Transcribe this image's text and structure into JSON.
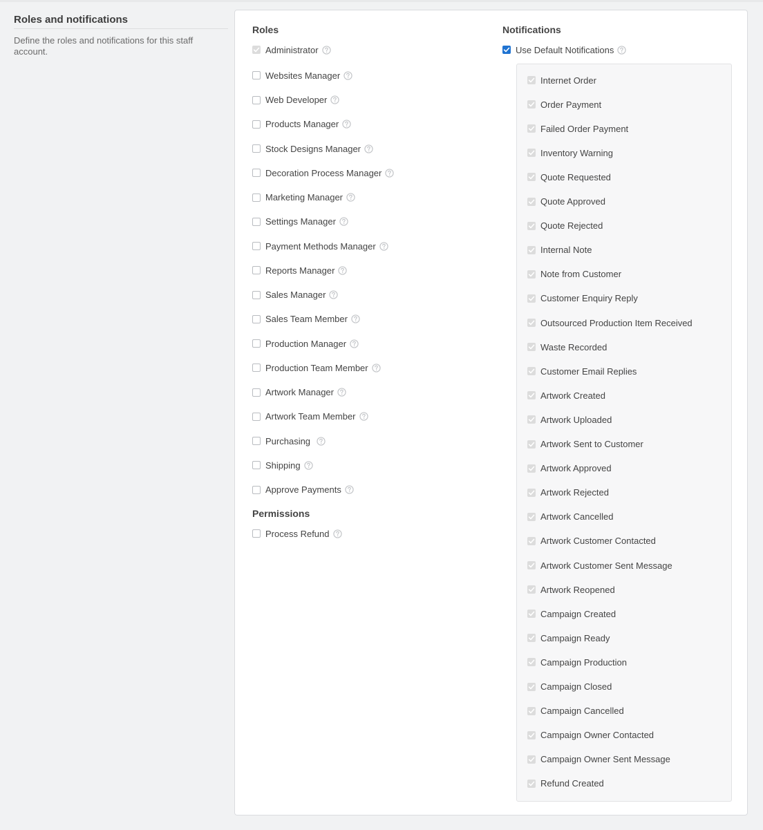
{
  "section": {
    "title": "Roles and notifications",
    "description": "Define the roles and notifications for this staff account."
  },
  "roles": {
    "heading": "Roles",
    "items": [
      {
        "label": "Administrator",
        "state": "disabled-checked"
      },
      {
        "label": "Websites Manager",
        "state": "unchecked"
      },
      {
        "label": "Web Developer",
        "state": "unchecked"
      },
      {
        "label": "Products Manager",
        "state": "unchecked"
      },
      {
        "label": "Stock Designs Manager",
        "state": "unchecked"
      },
      {
        "label": "Decoration Process Manager",
        "state": "unchecked"
      },
      {
        "label": "Marketing Manager",
        "state": "unchecked"
      },
      {
        "label": "Settings Manager",
        "state": "unchecked"
      },
      {
        "label": "Payment Methods Manager",
        "state": "unchecked"
      },
      {
        "label": "Reports Manager",
        "state": "unchecked"
      },
      {
        "label": "Sales Manager",
        "state": "unchecked"
      },
      {
        "label": "Sales Team Member",
        "state": "unchecked"
      },
      {
        "label": "Production Manager",
        "state": "unchecked"
      },
      {
        "label": "Production Team Member",
        "state": "unchecked"
      },
      {
        "label": "Artwork Manager",
        "state": "unchecked"
      },
      {
        "label": "Artwork Team Member",
        "state": "unchecked"
      },
      {
        "label": "Purchasing",
        "state": "unchecked"
      },
      {
        "label": "Shipping",
        "state": "unchecked"
      },
      {
        "label": "Approve Payments",
        "state": "unchecked"
      }
    ]
  },
  "permissions": {
    "heading": "Permissions",
    "items": [
      {
        "label": "Process Refund",
        "state": "unchecked"
      }
    ]
  },
  "notifications": {
    "heading": "Notifications",
    "use_default": {
      "label": "Use Default Notifications",
      "state": "checked"
    },
    "items": [
      {
        "label": "Internet Order",
        "state": "disabled-checked"
      },
      {
        "label": "Order Payment",
        "state": "disabled-checked"
      },
      {
        "label": "Failed Order Payment",
        "state": "disabled-checked"
      },
      {
        "label": "Inventory Warning",
        "state": "disabled-checked"
      },
      {
        "label": "Quote Requested",
        "state": "disabled-checked"
      },
      {
        "label": "Quote Approved",
        "state": "disabled-checked"
      },
      {
        "label": "Quote Rejected",
        "state": "disabled-checked"
      },
      {
        "label": "Internal Note",
        "state": "disabled-checked"
      },
      {
        "label": "Note from Customer",
        "state": "disabled-checked"
      },
      {
        "label": "Customer Enquiry Reply",
        "state": "disabled-checked"
      },
      {
        "label": "Outsourced Production Item Received",
        "state": "disabled-checked"
      },
      {
        "label": "Waste Recorded",
        "state": "disabled-checked"
      },
      {
        "label": "Customer Email Replies",
        "state": "disabled-checked"
      },
      {
        "label": "Artwork Created",
        "state": "disabled-checked"
      },
      {
        "label": "Artwork Uploaded",
        "state": "disabled-checked"
      },
      {
        "label": "Artwork Sent to Customer",
        "state": "disabled-checked"
      },
      {
        "label": "Artwork Approved",
        "state": "disabled-checked"
      },
      {
        "label": "Artwork Rejected",
        "state": "disabled-checked"
      },
      {
        "label": "Artwork Cancelled",
        "state": "disabled-checked"
      },
      {
        "label": "Artwork Customer Contacted",
        "state": "disabled-checked"
      },
      {
        "label": "Artwork Customer Sent Message",
        "state": "disabled-checked"
      },
      {
        "label": "Artwork Reopened",
        "state": "disabled-checked"
      },
      {
        "label": "Campaign Created",
        "state": "disabled-checked"
      },
      {
        "label": "Campaign Ready",
        "state": "disabled-checked"
      },
      {
        "label": "Campaign Production",
        "state": "disabled-checked"
      },
      {
        "label": "Campaign Closed",
        "state": "disabled-checked"
      },
      {
        "label": "Campaign Cancelled",
        "state": "disabled-checked"
      },
      {
        "label": "Campaign Owner Contacted",
        "state": "disabled-checked"
      },
      {
        "label": "Campaign Owner Sent Message",
        "state": "disabled-checked"
      },
      {
        "label": "Refund Created",
        "state": "disabled-checked"
      }
    ]
  },
  "icons": {
    "checkbox_check": "check-icon",
    "help": "help-circle-icon"
  },
  "colors": {
    "accent": "#1f73d1",
    "disabled_check": "#dcdcdc",
    "help_icon": "#c4c6c9"
  }
}
